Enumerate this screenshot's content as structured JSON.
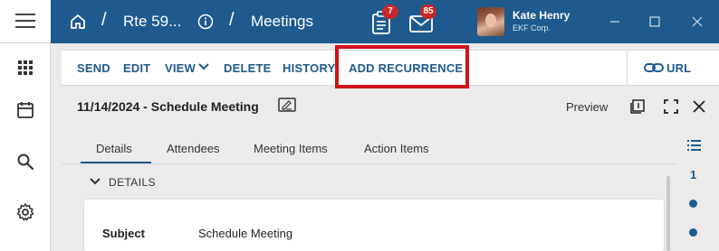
{
  "header": {
    "breadcrumb": {
      "record": "Rte 59...",
      "module": "Meetings",
      "separator": "/"
    },
    "notifications": {
      "tasks_count": "7",
      "mail_count": "85"
    },
    "user": {
      "name": "Kate Henry",
      "org": "EKF Corp."
    }
  },
  "toolbar": {
    "send": "SEND",
    "edit": "EDIT",
    "view": "VIEW",
    "delete": "DELETE",
    "history": "HISTORY",
    "add_recurrence": "ADD RECURRENCE",
    "url": "URL"
  },
  "record": {
    "title": "11/14/2024 - Schedule Meeting",
    "preview_label": "Preview"
  },
  "tabs": [
    {
      "label": "Details",
      "active": true
    },
    {
      "label": "Attendees",
      "active": false
    },
    {
      "label": "Meeting Items",
      "active": false
    },
    {
      "label": "Action Items",
      "active": false
    }
  ],
  "rail": {
    "section_number": "1"
  },
  "details": {
    "section_title": "DETAILS",
    "fields": [
      {
        "label": "Subject",
        "value": "Schedule Meeting"
      }
    ]
  },
  "colors": {
    "primary": "#1e5a8e",
    "highlight": "#d0121b",
    "badge": "#c62828"
  }
}
